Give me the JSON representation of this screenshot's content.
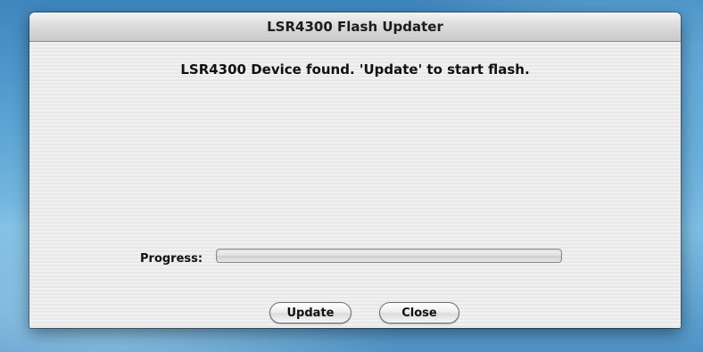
{
  "window": {
    "title": "LSR4300 Flash Updater"
  },
  "main": {
    "message": "LSR4300 Device found.  'Update' to start flash.",
    "progress_label": "Progress:",
    "progress_value": 0
  },
  "buttons": {
    "update_label": "Update",
    "close_label": "Close"
  }
}
